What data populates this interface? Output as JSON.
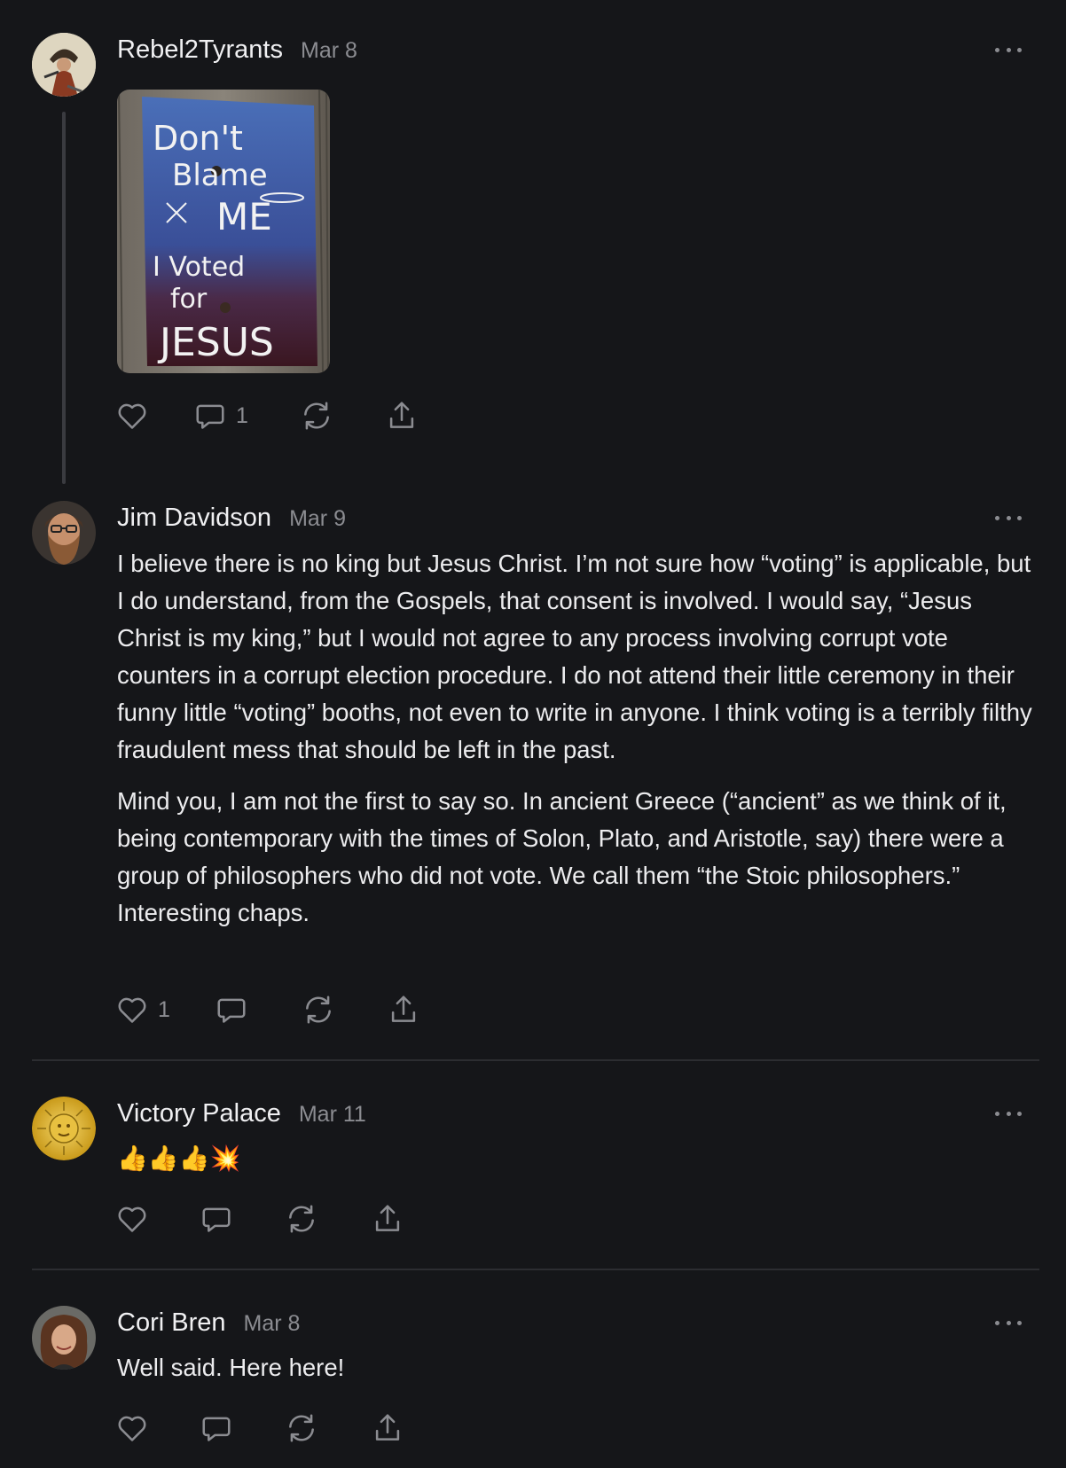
{
  "posts": [
    {
      "author": "Rebel2Tyrants",
      "date": "Mar 8",
      "image": {
        "lines": [
          "Don't",
          "Blame",
          "ME",
          "I Voted",
          "for",
          "JESUS"
        ]
      },
      "actions": {
        "like_count": "",
        "comment_count": "1"
      }
    },
    {
      "author": "Jim Davidson",
      "date": "Mar 9",
      "paragraphs": [
        "I believe there is no king but Jesus Christ. I’m not sure how “voting” is applicable, but I do understand, from the Gospels, that consent is involved. I would say, “Jesus Christ is my king,” but I would not agree to any process involving corrupt vote counters in a corrupt election procedure. I do not attend their little ceremony in their funny little “voting” booths, not even to write in anyone. I think voting is a terribly filthy fraudulent mess that should be left in the past.",
        "Mind you, I am not the first to say so. In ancient Greece (“ancient” as we think of it, being contemporary with the times of Solon, Plato, and Aristotle, say) there were a group of philosophers who did not vote. We call them “the Stoic philosophers.” Interesting chaps."
      ],
      "actions": {
        "like_count": "1",
        "comment_count": ""
      }
    },
    {
      "author": "Victory Palace",
      "date": "Mar 11",
      "text": "👍👍👍💥",
      "actions": {
        "like_count": "",
        "comment_count": ""
      }
    },
    {
      "author": "Cori Bren",
      "date": "Mar 8",
      "text": "Well said. Here here!",
      "actions": {
        "like_count": "",
        "comment_count": ""
      }
    }
  ],
  "icons": [
    "heart-icon",
    "comment-icon",
    "restack-icon",
    "share-icon",
    "more-icon"
  ],
  "colors": {
    "background": "#151619",
    "text": "#ececee",
    "muted": "#8b8c91",
    "divider": "#2c2d31"
  }
}
